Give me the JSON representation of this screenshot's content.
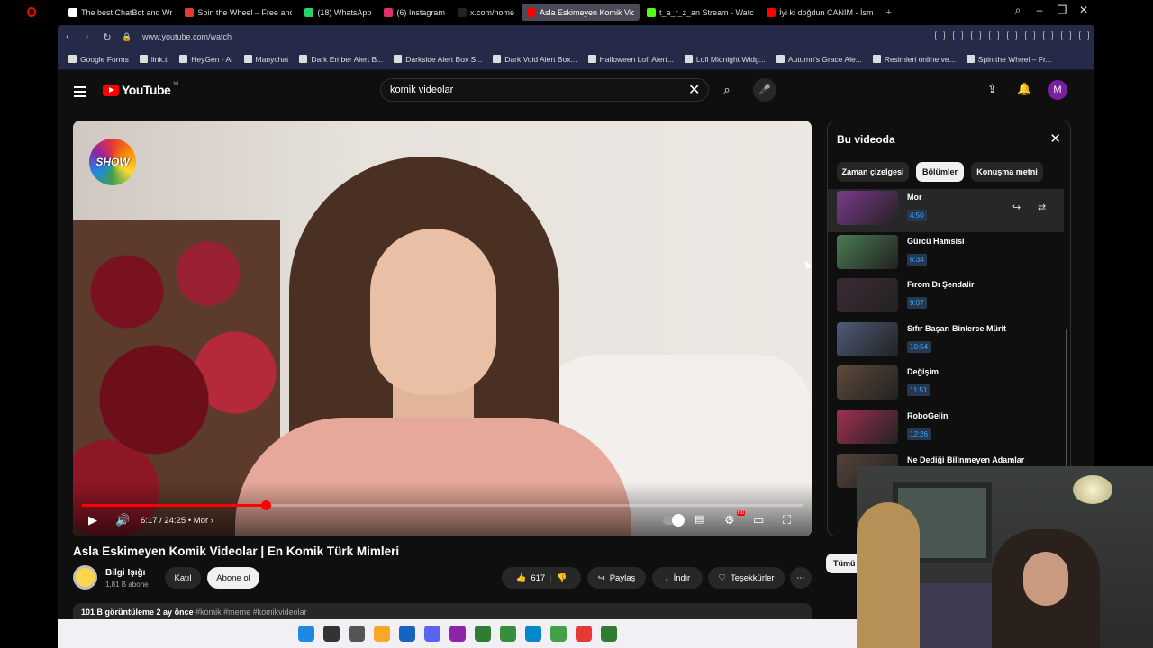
{
  "browser": {
    "tabs": [
      {
        "title": "The best ChatBot and Wr",
        "color": "#fff"
      },
      {
        "title": "Spin the Wheel – Free and",
        "color": "#e53935"
      },
      {
        "title": "(18) WhatsApp",
        "color": "#25d366"
      },
      {
        "title": "(6) Instagram",
        "color": "#e1306c"
      },
      {
        "title": "x.com/home",
        "color": "#222"
      },
      {
        "title": "Asla Eskimeyen Komik Vid",
        "color": "#f00"
      },
      {
        "title": "t_a_r_z_an Stream - Watch",
        "color": "#53fc18"
      },
      {
        "title": "İyi ki doğdun CANIM - İsm",
        "color": "#f00"
      }
    ],
    "url": "www.youtube.com/watch",
    "bookmarks": [
      "Google Forms",
      "link.tl",
      "HeyGen - AI",
      "Manychat",
      "Dark Ember Alert B...",
      "Darkside Alert Box S...",
      "Dark Void Alert Box...",
      "Halloween Lofi Alert...",
      "Lofi Midnight Widg...",
      "Autumn's Grace Ale...",
      "Resimleri online ve...",
      "Spin the Wheel – Fr..."
    ]
  },
  "youtube": {
    "logo": "YouTube",
    "country": "NL",
    "search_value": "komik videolar",
    "avatar_letter": "M"
  },
  "player": {
    "progress": 0.255,
    "time": "6:17 / 24:25",
    "chapter": "• Mor",
    "hd_badge": "HD",
    "channel_logo": "SHOW"
  },
  "video": {
    "title": "Asla Eskimeyen Komik Videolar | En Komik Türk Mimleri",
    "channel": "Bilgi Işığı",
    "subscribers": "1,81 B abone",
    "join": "Katıl",
    "subscribe": "Abone ol",
    "likes": "617",
    "share": "Paylaş",
    "download": "İndir",
    "thanks": "Teşekkürler",
    "views": "101 B görüntüleme",
    "age": "2 ay önce",
    "tags": "#komik #meme #komikvideolar"
  },
  "panel": {
    "title": "Bu videoda",
    "tabs": [
      "Zaman çizelgesi",
      "Bölümler",
      "Konuşma metni"
    ],
    "chapters": [
      {
        "title": "Mor",
        "time": "4:50",
        "thumb": "#7b3a8c"
      },
      {
        "title": "Gürcü Hamsisi",
        "time": "6:34",
        "thumb": "#4a7a52"
      },
      {
        "title": "Fırom Dı Şendalir",
        "time": "9:07",
        "thumb": "#3d2a35"
      },
      {
        "title": "Sıfır Başarı Binlerce Mürit",
        "time": "10:54",
        "thumb": "#4e5a78"
      },
      {
        "title": "Değişim",
        "time": "11:51",
        "thumb": "#5e4a3c"
      },
      {
        "title": "RoboGelin",
        "time": "12:26",
        "thumb": "#a03050"
      },
      {
        "title": "Ne Dediği Bilinmeyen Adamlar",
        "time": "",
        "thumb": "#55433a"
      }
    ],
    "all_button": "Tümü"
  },
  "taskbar_colors": [
    "#1e88e5",
    "#333",
    "#555",
    "#f9a825",
    "#1565c0",
    "#5865f2",
    "#8e24aa",
    "#2e7d32",
    "#388e3c",
    "#0088cc",
    "#43a047",
    "#e53935",
    "#2e7d32"
  ]
}
